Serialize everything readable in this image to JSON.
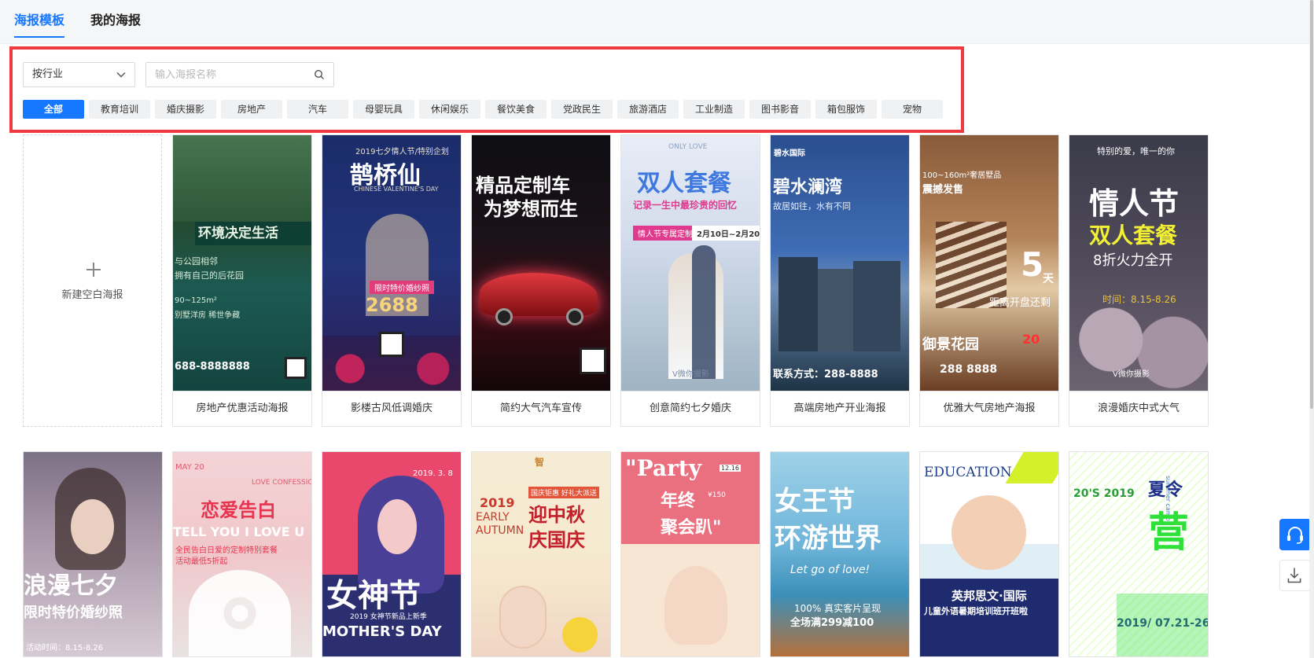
{
  "tabs": [
    {
      "label": "海报模板",
      "active": true
    },
    {
      "label": "我的海报",
      "active": false
    }
  ],
  "filter": {
    "select_value": "按行业",
    "search_placeholder": "输入海报名称"
  },
  "categories": [
    "全部",
    "教育培训",
    "婚庆摄影",
    "房地产",
    "汽车",
    "母婴玩具",
    "休闲娱乐",
    "餐饮美食",
    "党政民生",
    "旅游酒店",
    "工业制造",
    "图书影音",
    "箱包服饰",
    "宠物"
  ],
  "blank_label": "新建空白海报",
  "row1": [
    {
      "caption": "房地产优惠活动海报",
      "headline": "环境决定生活",
      "sub1": "与公园相邻",
      "sub2": "拥有自己的后花园",
      "sub3": "90~125m²",
      "sub4": "别墅洋房 稀世争藏",
      "phone": "688-8888888"
    },
    {
      "caption": "影楼古风低调婚庆",
      "top": "2019七夕情人节/特别企划",
      "headline": "鹊桥仙",
      "en": "CHINESE VALENTINE'S DAY",
      "badge": "限时特价婚纱照",
      "price": "2688"
    },
    {
      "caption": "简约大气汽车宣传",
      "headline1": "精品定制车",
      "headline2": "为梦想而生"
    },
    {
      "caption": "创意简约七夕婚庆",
      "en": "ONLY LOVE",
      "headline": "双人套餐",
      "sub": "记录一生中最珍贵的回忆",
      "badge": "情人节专属定制",
      "date": "2月10日~2月20",
      "foot": "V微你摄影"
    },
    {
      "caption": "高端房地产开业海报",
      "brand": "碧水国际",
      "headline": "碧水澜湾",
      "sub": "故居如往，水有不同",
      "phone": "联系方式：288-8888"
    },
    {
      "caption": "优雅大气房地产海报",
      "top": "100~160m²奢居墅品",
      "sub": "震撼发售",
      "big": "5",
      "unit": "天",
      "line": "距离开盘还剩",
      "name": "御景花园",
      "price": "20",
      "phone": "288 8888"
    },
    {
      "caption": "浪漫婚庆中式大气",
      "top": "特别的爱，唯一的你",
      "headline": "情人节",
      "sub": "双人套餐",
      "line": "8折火力全开",
      "date": "时间：8.15-8.26",
      "foot": "V微你摄影"
    }
  ],
  "row2": [
    {
      "headline": "浪漫七夕",
      "sub": "限时特价婚纱照",
      "date": "活动时间：8.15-8.26"
    },
    {
      "top": "MAY 20",
      "en": "LOVE CONFESSION",
      "headline": "恋爱告白",
      "en2": "TELL YOU I LOVE U",
      "sub": "全民告白日爱的定制特别套餐",
      "sub2": "活动最低5折起"
    },
    {
      "date": "2019. 3. 8",
      "headline": "女神节",
      "sub": "2019 女神节新品上新季",
      "en": "MOTHER'S DAY"
    },
    {
      "brand": "智",
      "year": "2019",
      "en1": "EARLY",
      "en2": "AUTUMN",
      "sub": "国庆钜惠 好礼大派送",
      "headline1": "迎中秋",
      "headline2": "庆国庆"
    },
    {
      "en": "\"Party",
      "headline": "年终",
      "headline2": "聚会趴\"",
      "price": "¥150",
      "date": "12.16"
    },
    {
      "headline1": "女王节",
      "headline2": "环游世界",
      "en": "Let go of love!",
      "sub": "100% 真实客片呈现",
      "sub2": "全场满299减100"
    },
    {
      "en": "EDUCATION",
      "headline": "英邦思文·国际",
      "sub": "儿童外语暑期培训班开班啦"
    },
    {
      "en": "summer camp",
      "headline1": "夏令",
      "headline2": "营",
      "year": "20'S 2019",
      "date": "2019/ 07.21-26"
    }
  ],
  "colors": {
    "accent": "#1677ff",
    "highlight": "#ef3b3f"
  }
}
